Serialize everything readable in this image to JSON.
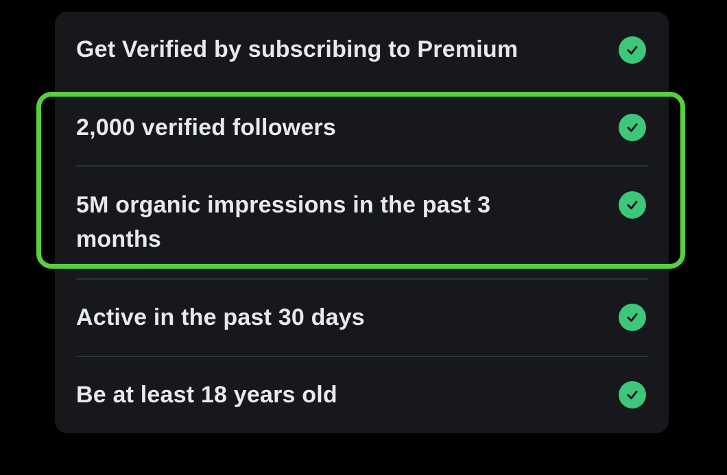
{
  "requirements": [
    {
      "label": "Get Verified by subscribing to Premium",
      "status_icon": "check-circle-icon"
    },
    {
      "label": "2,000 verified followers",
      "status_icon": "check-circle-icon"
    },
    {
      "label_line1": "5M organic impressions in the past 3",
      "label_line2": "months",
      "status_icon": "check-circle-icon"
    },
    {
      "label": "Active in the past 30 days",
      "status_icon": "check-circle-icon"
    },
    {
      "label": "Be at least 18 years old",
      "status_icon": "check-circle-icon"
    }
  ],
  "colors": {
    "background": "#000000",
    "card": "#16181c",
    "text": "#e7e9ea",
    "check": "#3cc77a",
    "highlight": "#55d13e"
  }
}
